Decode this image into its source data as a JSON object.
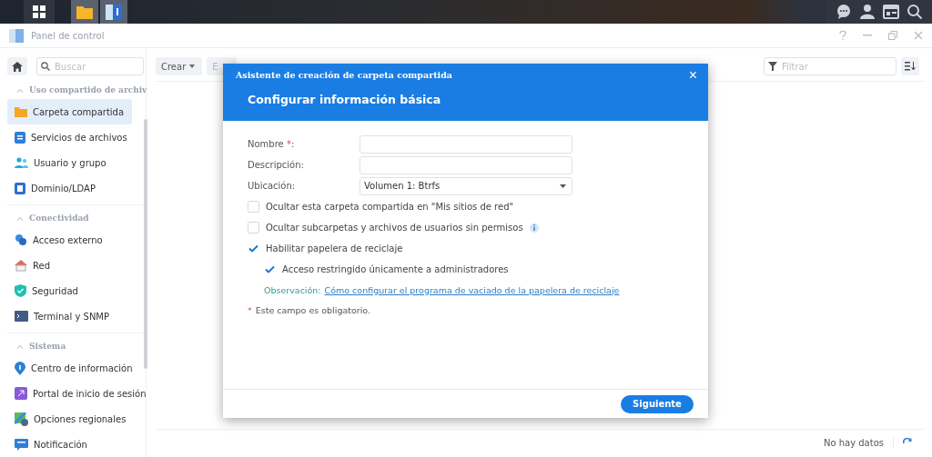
{
  "window": {
    "title": "Panel de control"
  },
  "sidebar": {
    "search": {
      "placeholder": "Buscar"
    },
    "sections": [
      {
        "title": "Uso compartido de archiv",
        "expanded": true,
        "items": [
          {
            "label": "Carpeta compartida",
            "selected": true
          },
          {
            "label": "Servicios de archivos",
            "selected": false
          },
          {
            "label": "Usuario y grupo",
            "selected": false
          },
          {
            "label": "Dominio/LDAP",
            "selected": false
          }
        ]
      },
      {
        "title": "Conectividad",
        "expanded": true,
        "items": [
          {
            "label": "Acceso externo",
            "selected": false
          },
          {
            "label": "Red",
            "selected": false
          },
          {
            "label": "Seguridad",
            "selected": false
          },
          {
            "label": "Terminal y SNMP",
            "selected": false
          }
        ]
      },
      {
        "title": "Sistema",
        "expanded": true,
        "items": [
          {
            "label": "Centro de información",
            "selected": false
          },
          {
            "label": "Portal de inicio de sesión",
            "selected": false
          },
          {
            "label": "Opciones regionales",
            "selected": false
          },
          {
            "label": "Notificación",
            "selected": false
          }
        ]
      }
    ]
  },
  "toolbar": {
    "buttons": [
      {
        "label": "Crear",
        "menu": true
      },
      {
        "label": "E",
        "menu": false
      }
    ],
    "filter": {
      "placeholder": "Filtrar"
    }
  },
  "status_bar": {
    "text": "No hay datos"
  },
  "dialog": {
    "title": "Asistente de creación de carpeta compartida",
    "close": "×",
    "heading": "Configurar información básica",
    "fields": [
      {
        "kind": "text",
        "label": "Nombre ",
        "required_mark": "*",
        "label_end": ":"
      },
      {
        "kind": "text",
        "label": "Descripción:"
      },
      {
        "kind": "select",
        "label": "Ubicación:",
        "value": "Volumen 1:  Btrfs"
      }
    ],
    "options": [
      {
        "label": "Ocultar esta carpeta compartida en \"Mis sitios de red\"",
        "checked": false,
        "info": false
      },
      {
        "label": "Ocultar subcarpetas y archivos de usuarios sin permisos",
        "checked": false,
        "info": true
      },
      {
        "label": "Habilitar papelera de reciclaje",
        "checked": true,
        "info": false,
        "children": [
          {
            "label": "Acceso restringido únicamente a administradores",
            "checked": true,
            "info": false
          }
        ]
      }
    ],
    "note": {
      "label": "Observación:",
      "link": "Cómo configurar el programa de vaciado de la papelera de reciclaje"
    },
    "required_note": {
      "mark": "*",
      "text": "Este campo es obligatorio."
    },
    "next_button": "Siguiente"
  }
}
